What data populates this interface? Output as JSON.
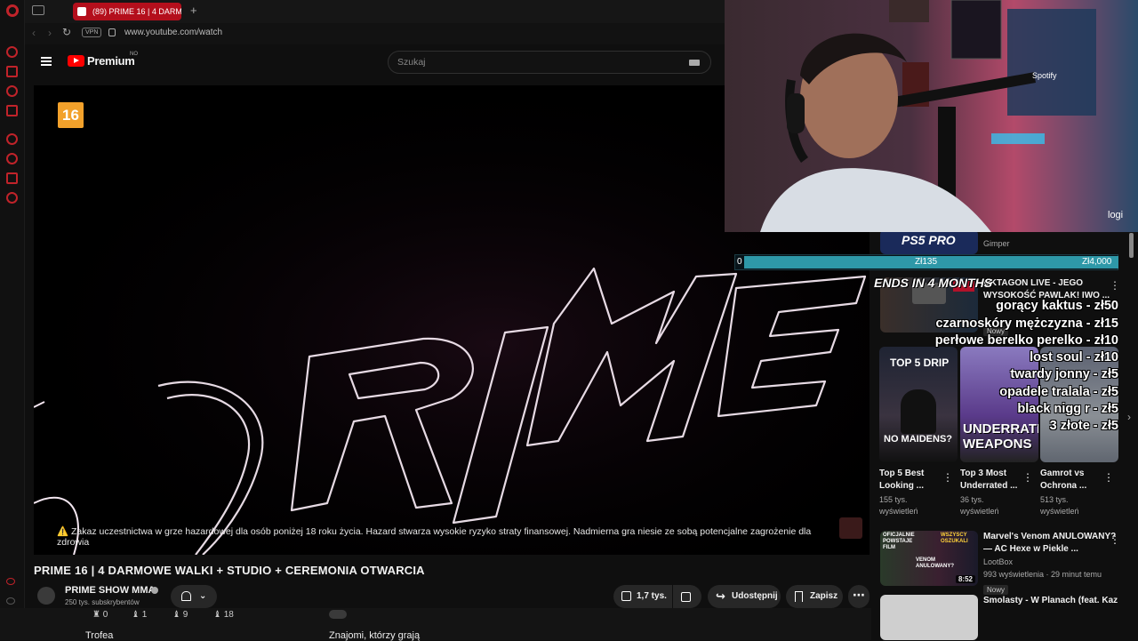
{
  "browser": {
    "tab_title": "(89) PRIME 16 | 4 DARM",
    "new_tab": "+",
    "vpn": "VPN",
    "url": "www.youtube.com/watch"
  },
  "youtube": {
    "logo": "Premium",
    "region": "NO",
    "search_placeholder": "Szukaj"
  },
  "player": {
    "age_rating": "16",
    "warning": "⚠️ Zakaz uczestnictwa w grze hazardowej dla osób poniżej 18 roku życia. Hazard stwarza wysokie ryzyko straty finansowej. Nadmierna gra niesie ze sobą potencjalne zagrożenie dla zdrowia"
  },
  "video": {
    "title": "PRIME 16 | 4 DARMOWE WALKI + STUDIO + CEREMONIA OTWARCIA",
    "channel": "PRIME SHOW MMA",
    "subscribers": "250 tys. subskrybentów",
    "likes": "1,7 tys.",
    "share": "Udostępnij",
    "save": "Zapisz"
  },
  "overlay": {
    "goal_start": "0",
    "goal_current": "Zł135",
    "goal_target": "Zł4,000",
    "ends_label": "ENDS IN 4 MONTHS",
    "donations": [
      "gorący kaktus - zł50",
      "czarnoskóry mężczyzna - zł15",
      "perłowe berelko perelko - zł10",
      "lost soul - zł10",
      "twardy jonny - zł5",
      "opadele tralala - zł5",
      "black nigg r - zł5",
      "3 złote - zł5"
    ],
    "webcam_brand": "logi",
    "poster_brand": "Spotify"
  },
  "sidebar": {
    "item0": {
      "thumb_text": "PS5 PRO",
      "channel": "Gimper"
    },
    "item1": {
      "title_line1": "OKTAGON LIVE - JEGO",
      "title_line2": "WYSOKOŚĆ PAWLAK! IWO ...",
      "badge": "Nowy"
    },
    "shorts": [
      {
        "thumb_top": "TOP 5 DRIP",
        "thumb_bottom": "NO MAIDENS?",
        "title1": "Top 5 Best",
        "title2": "Looking ...",
        "views1": "155 tys.",
        "views2": "wyświetleń"
      },
      {
        "thumb_bottom": "UNDERRATED WEAPONS",
        "title1": "Top 3 Most",
        "title2": "Underrated ...",
        "views1": "36 tys.",
        "views2": "wyświetleń"
      },
      {
        "title1": "Gamrot vs",
        "title2": "Ochrona ...",
        "views1": "513 tys.",
        "views2": "wyświetleń"
      }
    ],
    "item3": {
      "title_line1": "Marvel's Venom ANULOWANY?",
      "title_line2": "— AC Hexe w Piekle ...",
      "channel": "LootBox",
      "meta": "993 wyświetlenia · 29 minut temu",
      "badge": "Nowy",
      "duration": "8:52",
      "thumb_text1": "OFICJALNIE POWSTAJE FILM",
      "thumb_text2": "WSZYSCY OSZUKALI",
      "thumb_text3": "VENOM ANULOWANY?"
    },
    "item4": {
      "title_line1": "Smolasty - W Planach (feat. Kaz"
    }
  },
  "bottom": {
    "trophy_counts": [
      "0",
      "1",
      "9",
      "18"
    ],
    "trophies_label": "Trofea",
    "friends_label": "Znajomi, którzy grają"
  }
}
